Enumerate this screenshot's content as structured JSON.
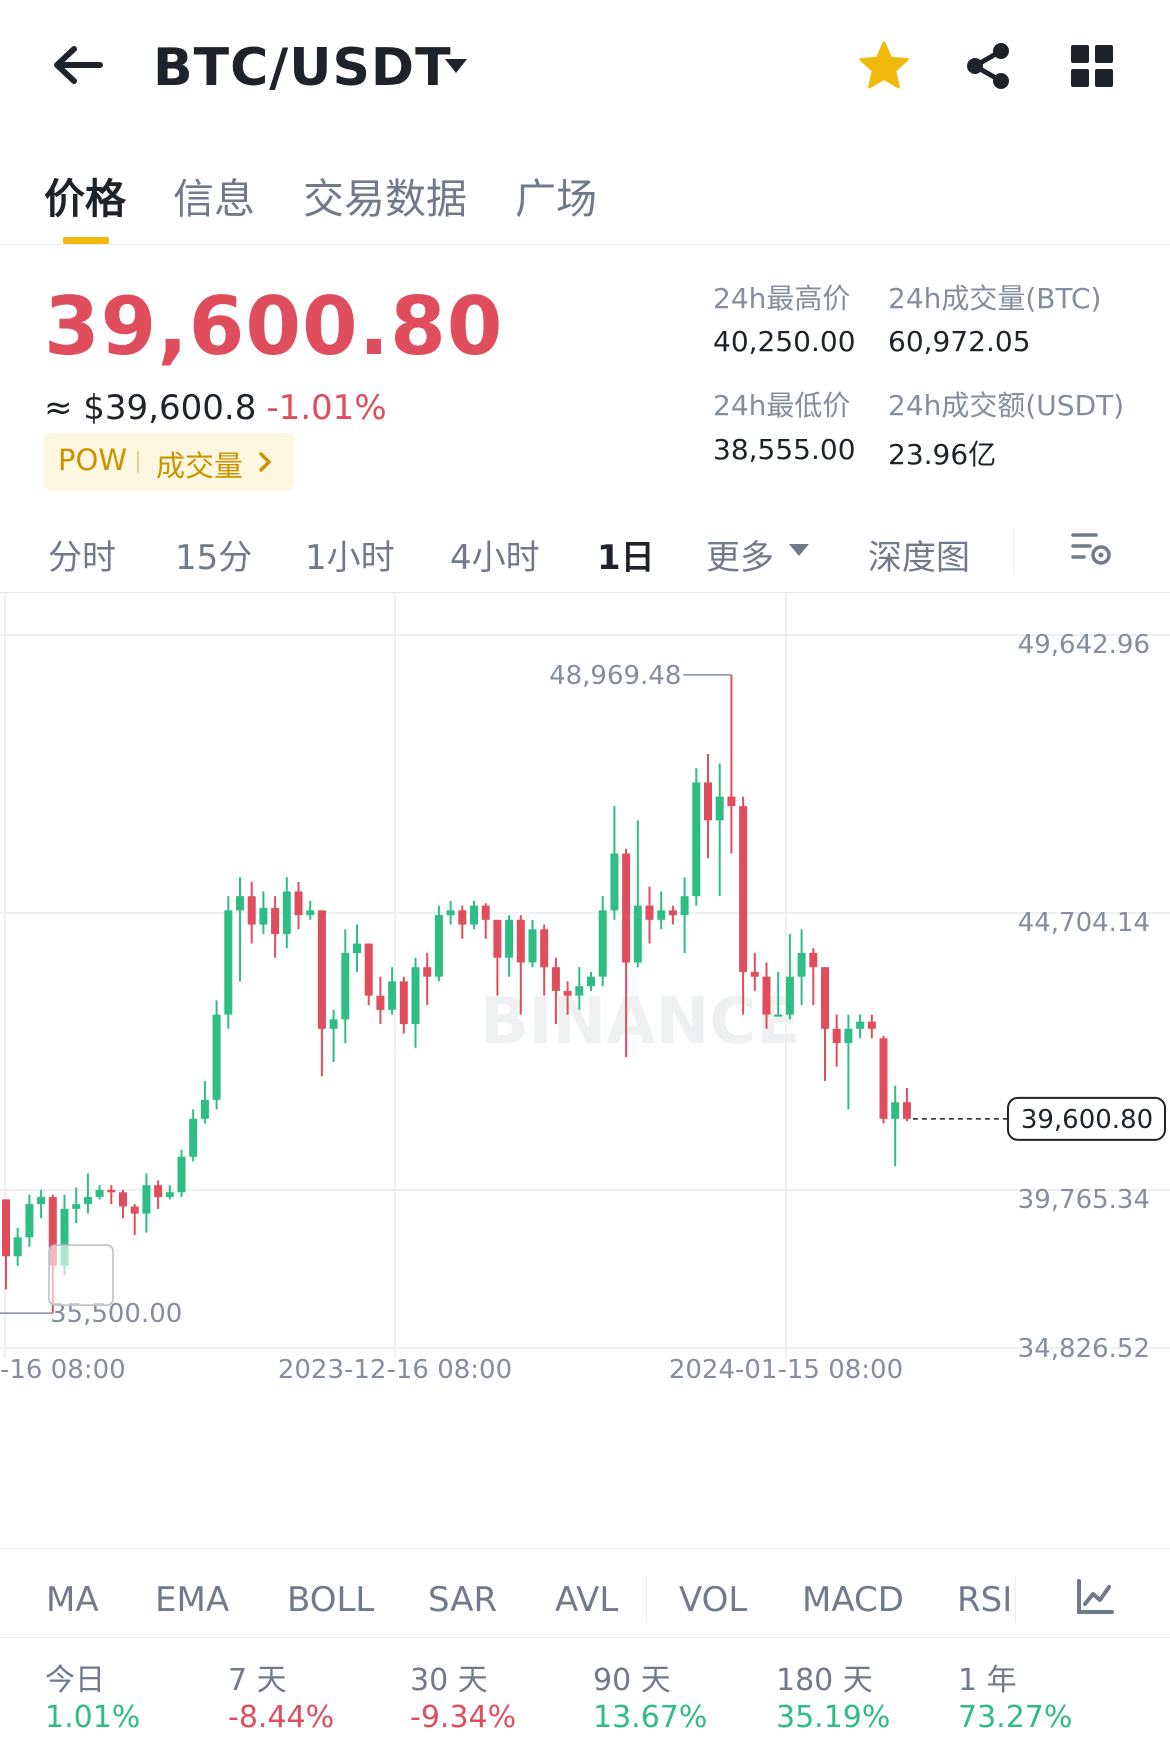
{
  "header": {
    "pair": "BTC/USDT",
    "icons": {
      "back": "back-arrow-icon",
      "dropdown": "caret-down-icon",
      "favorite": "star-icon",
      "share": "share-icon",
      "apps": "grid-icon"
    },
    "favorite_color": "#f0b90b"
  },
  "tabs": [
    "价格",
    "信息",
    "交易数据",
    "广场"
  ],
  "active_tab": "价格",
  "price": {
    "last": "39,600.80",
    "usd": "≈ $39,600.8",
    "change": "-1.01%",
    "tag_pow": "POW",
    "tag_volume": "成交量",
    "color": "#e04d5d"
  },
  "stats": {
    "high_label": "24h最高价",
    "high": "40,250.00",
    "vol_btc_label": "24h成交量(BTC)",
    "vol_btc": "60,972.05",
    "low_label": "24h最低价",
    "low": "38,555.00",
    "vol_usdt_label": "24h成交额(USDT)",
    "vol_usdt": "23.96亿"
  },
  "intervals": {
    "items": [
      "分时",
      "15分",
      "1小时",
      "4小时",
      "1日"
    ],
    "active": "1日",
    "more": "更多",
    "depth": "深度图"
  },
  "chart_data": {
    "type": "candlestick",
    "interval": "1日",
    "up_color": "#2ebd85",
    "down_color": "#e04d5d",
    "y_axis_labels": [
      "49,642.96",
      "44,704.14",
      "39,765.34",
      "34,826.52"
    ],
    "x_axis_labels": [
      "-16 08:00",
      "2023-12-16 08:00",
      "2024-01-15 08:00"
    ],
    "ylim": [
      34826.52,
      49642.96
    ],
    "grid": true,
    "annotations": {
      "max": "48,969.48",
      "min": "35,500.00"
    },
    "last_price_label": "39,600.80",
    "watermark": "BINANCE",
    "candles": [
      {
        "o": 37900,
        "c": 36700,
        "h": 37900,
        "l": 36000
      },
      {
        "o": 36700,
        "c": 37100,
        "h": 37300,
        "l": 36500
      },
      {
        "o": 37100,
        "c": 37800,
        "h": 38000,
        "l": 36900
      },
      {
        "o": 37800,
        "c": 37950,
        "h": 38100,
        "l": 37500
      },
      {
        "o": 37950,
        "c": 36500,
        "h": 38000,
        "l": 35500
      },
      {
        "o": 36500,
        "c": 37700,
        "h": 38000,
        "l": 36300
      },
      {
        "o": 37700,
        "c": 37800,
        "h": 38150,
        "l": 37400
      },
      {
        "o": 37800,
        "c": 37950,
        "h": 38450,
        "l": 37600
      },
      {
        "o": 37950,
        "c": 38100,
        "h": 38200,
        "l": 37900
      },
      {
        "o": 38100,
        "c": 38050,
        "h": 38200,
        "l": 37800
      },
      {
        "o": 38050,
        "c": 37750,
        "h": 38100,
        "l": 37500
      },
      {
        "o": 37750,
        "c": 37600,
        "h": 37800,
        "l": 37150
      },
      {
        "o": 37600,
        "c": 38200,
        "h": 38450,
        "l": 37200
      },
      {
        "o": 38200,
        "c": 37950,
        "h": 38300,
        "l": 37700
      },
      {
        "o": 37950,
        "c": 38050,
        "h": 38200,
        "l": 37900
      },
      {
        "o": 38050,
        "c": 38800,
        "h": 38950,
        "l": 37950
      },
      {
        "o": 38800,
        "c": 39600,
        "h": 39800,
        "l": 38700
      },
      {
        "o": 39600,
        "c": 40000,
        "h": 40400,
        "l": 39500
      },
      {
        "o": 40000,
        "c": 41800,
        "h": 42100,
        "l": 39800
      },
      {
        "o": 41800,
        "c": 44000,
        "h": 44300,
        "l": 41500
      },
      {
        "o": 44000,
        "c": 44300,
        "h": 44700,
        "l": 42500
      },
      {
        "o": 44300,
        "c": 43700,
        "h": 44600,
        "l": 43300
      },
      {
        "o": 43700,
        "c": 44050,
        "h": 44400,
        "l": 43500
      },
      {
        "o": 44050,
        "c": 43500,
        "h": 44300,
        "l": 43000
      },
      {
        "o": 43500,
        "c": 44400,
        "h": 44700,
        "l": 43200
      },
      {
        "o": 44400,
        "c": 43900,
        "h": 44600,
        "l": 43600
      },
      {
        "o": 43900,
        "c": 44000,
        "h": 44200,
        "l": 43800
      },
      {
        "o": 44000,
        "c": 41500,
        "h": 44000,
        "l": 40500
      },
      {
        "o": 41500,
        "c": 41700,
        "h": 41900,
        "l": 40800
      },
      {
        "o": 41700,
        "c": 43100,
        "h": 43600,
        "l": 41200
      },
      {
        "o": 43100,
        "c": 43300,
        "h": 43700,
        "l": 42700
      },
      {
        "o": 43300,
        "c": 42200,
        "h": 43300,
        "l": 42000
      },
      {
        "o": 42200,
        "c": 41900,
        "h": 42600,
        "l": 41600
      },
      {
        "o": 41900,
        "c": 42500,
        "h": 42800,
        "l": 41800
      },
      {
        "o": 42500,
        "c": 41600,
        "h": 42600,
        "l": 41400
      },
      {
        "o": 41600,
        "c": 42800,
        "h": 43000,
        "l": 41100
      },
      {
        "o": 42800,
        "c": 42600,
        "h": 43100,
        "l": 42000
      },
      {
        "o": 42600,
        "c": 43900,
        "h": 44100,
        "l": 42500
      },
      {
        "o": 43900,
        "c": 44000,
        "h": 44200,
        "l": 43700
      },
      {
        "o": 44000,
        "c": 43700,
        "h": 44100,
        "l": 43400
      },
      {
        "o": 43700,
        "c": 44100,
        "h": 44200,
        "l": 43600
      },
      {
        "o": 44100,
        "c": 43800,
        "h": 44150,
        "l": 43400
      },
      {
        "o": 43800,
        "c": 43000,
        "h": 43800,
        "l": 42200
      },
      {
        "o": 43000,
        "c": 43800,
        "h": 43900,
        "l": 42600
      },
      {
        "o": 43800,
        "c": 42900,
        "h": 43900,
        "l": 41800
      },
      {
        "o": 42900,
        "c": 43600,
        "h": 43800,
        "l": 42800
      },
      {
        "o": 43600,
        "c": 42800,
        "h": 43700,
        "l": 42200
      },
      {
        "o": 42800,
        "c": 42300,
        "h": 43000,
        "l": 41600
      },
      {
        "o": 42300,
        "c": 42200,
        "h": 42500,
        "l": 41800
      },
      {
        "o": 42200,
        "c": 42400,
        "h": 42800,
        "l": 41900
      },
      {
        "o": 42400,
        "c": 42600,
        "h": 42700,
        "l": 42300
      },
      {
        "o": 42600,
        "c": 44000,
        "h": 44300,
        "l": 42400
      },
      {
        "o": 44000,
        "c": 45200,
        "h": 46200,
        "l": 43800
      },
      {
        "o": 45200,
        "c": 42900,
        "h": 45300,
        "l": 40900
      },
      {
        "o": 42900,
        "c": 44100,
        "h": 45900,
        "l": 42800
      },
      {
        "o": 44100,
        "c": 43800,
        "h": 44500,
        "l": 43300
      },
      {
        "o": 43800,
        "c": 44000,
        "h": 44400,
        "l": 43600
      },
      {
        "o": 44000,
        "c": 43900,
        "h": 44100,
        "l": 43700
      },
      {
        "o": 43900,
        "c": 44300,
        "h": 44700,
        "l": 43100
      },
      {
        "o": 44300,
        "c": 46700,
        "h": 47000,
        "l": 44100
      },
      {
        "o": 46700,
        "c": 45900,
        "h": 47300,
        "l": 45100
      },
      {
        "o": 45900,
        "c": 46400,
        "h": 47100,
        "l": 44300
      },
      {
        "o": 46400,
        "c": 46200,
        "h": 48970,
        "l": 45200
      },
      {
        "o": 46200,
        "c": 42700,
        "h": 46400,
        "l": 41800
      },
      {
        "o": 42700,
        "c": 42600,
        "h": 43100,
        "l": 42300
      },
      {
        "o": 42600,
        "c": 41800,
        "h": 42900,
        "l": 41500
      },
      {
        "o": 41800,
        "c": 41800,
        "h": 42700,
        "l": 41800
      },
      {
        "o": 41800,
        "c": 42600,
        "h": 43500,
        "l": 41700
      },
      {
        "o": 42600,
        "c": 43100,
        "h": 43600,
        "l": 42000
      },
      {
        "o": 43100,
        "c": 42800,
        "h": 43200,
        "l": 42000
      },
      {
        "o": 42800,
        "c": 41500,
        "h": 42800,
        "l": 40400
      },
      {
        "o": 41500,
        "c": 41200,
        "h": 41800,
        "l": 40700
      },
      {
        "o": 41200,
        "c": 41500,
        "h": 41800,
        "l": 39800
      },
      {
        "o": 41500,
        "c": 41650,
        "h": 41800,
        "l": 41300
      },
      {
        "o": 41650,
        "c": 41500,
        "h": 41800,
        "l": 41300
      },
      {
        "o": 41300,
        "c": 39600,
        "h": 41350,
        "l": 39500
      },
      {
        "o": 39600,
        "c": 39950,
        "h": 40300,
        "l": 38600
      },
      {
        "o": 39950,
        "c": 39600,
        "h": 40250,
        "l": 39550
      }
    ]
  },
  "indicators": [
    "MA",
    "EMA",
    "BOLL",
    "SAR",
    "AVL",
    "VOL",
    "MACD",
    "RSI"
  ],
  "performance": [
    {
      "label": "今日",
      "value": "1.01%",
      "dir": "up"
    },
    {
      "label": "7 天",
      "value": "-8.44%",
      "dir": "down"
    },
    {
      "label": "30 天",
      "value": "-9.34%",
      "dir": "down"
    },
    {
      "label": "90 天",
      "value": "13.67%",
      "dir": "up"
    },
    {
      "label": "180 天",
      "value": "35.19%",
      "dir": "up"
    },
    {
      "label": "1 年",
      "value": "73.27%",
      "dir": "up"
    }
  ]
}
